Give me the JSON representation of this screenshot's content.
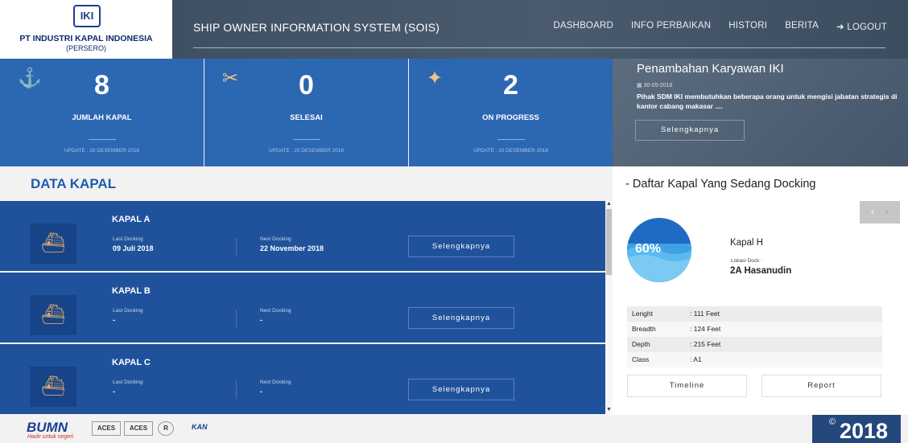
{
  "brand": {
    "logo_text": "IKI",
    "name": "PT INDUSTRI KAPAL INDONESIA",
    "sub": "(PERSERO)"
  },
  "header": {
    "title": "SHIP OWNER INFORMATION SYSTEM (SOIS)"
  },
  "nav": [
    "DASHBOARD",
    "INFO PERBAIKAN",
    "HISTORI",
    "BERITA",
    "LOGOUT"
  ],
  "stats": [
    {
      "icon": "crane-icon",
      "value": "8",
      "label": "JUMLAH KAPAL",
      "updated": "UPDATE : 20 DESEMBER 2018"
    },
    {
      "icon": "tools-icon",
      "value": "0",
      "label": "SELESAI",
      "updated": "UPDATE : 20 DESEMBER 2018"
    },
    {
      "icon": "welding-icon",
      "value": "2",
      "label": "ON PROGRESS",
      "updated": "UPDATE : 20 DESEMBER 2018"
    }
  ],
  "news": {
    "title": "Penambahan Karyawan IKI",
    "date": "30-05-2018",
    "body": "Pihak SDM IKI membutuhkan beberapa orang untuk mengisi jabatan strategis di kantor cabang makasar ....",
    "more_label": "Selengkapnya"
  },
  "data_kapal": {
    "heading": "DATA KAPAL",
    "ships": [
      {
        "name": "KAPAL A",
        "last_label": "Last Docking",
        "last_value": "09 Juli 2018",
        "next_label": "Next Docking",
        "next_value": "22 November 2018",
        "button": "Selengkapnya"
      },
      {
        "name": "KAPAL B",
        "last_label": "Last Docking",
        "last_value": "-",
        "next_label": "Next Docking",
        "next_value": "-",
        "button": "Selengkapnya"
      },
      {
        "name": "KAPAL C",
        "last_label": "Last Docking",
        "last_value": "-",
        "next_label": "Next Docking",
        "next_value": "-",
        "button": "Selengkapnya"
      }
    ]
  },
  "docking": {
    "heading": "- Daftar Kapal Yang Sedang Docking",
    "progress_percent": 60,
    "progress_label": "60%",
    "ship_name": "Kapal H",
    "location_label": "Lokasi Dock :",
    "location_value": "2A Hasanudin",
    "specs": [
      {
        "key": "Lenght",
        "value": ":   111 Feet"
      },
      {
        "key": "Breadth",
        "value": ":   124 Feet"
      },
      {
        "key": "Depth",
        "value": ":   215 Feet"
      },
      {
        "key": "Class",
        "value": ":   A1"
      }
    ],
    "timeline_label": "Timeline",
    "report_label": "Report"
  },
  "footer": {
    "bumn": "BUMN",
    "bumn_tagline": "Hadir untuk negeri",
    "cert1": "ACES",
    "cert2": "ACES",
    "cert3": "R",
    "kan": "KAN",
    "copyright_symbol": "©",
    "year": "2018"
  },
  "colors": {
    "primary": "#2c67b2",
    "row": "#20529c",
    "accent": "#1e5bb0",
    "icon": "#f0c28a"
  }
}
